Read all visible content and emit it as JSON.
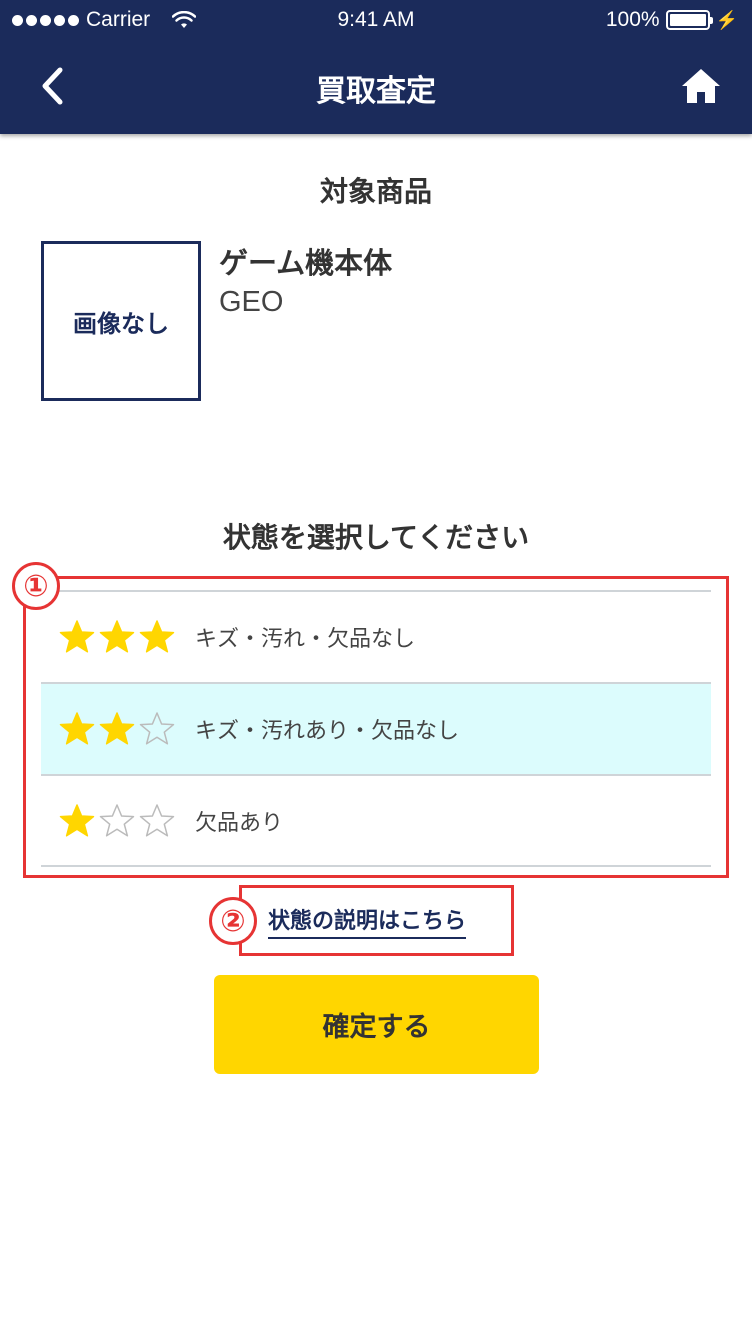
{
  "status_bar": {
    "carrier": "Carrier",
    "time": "9:41 AM",
    "battery": "100%"
  },
  "nav": {
    "title": "買取査定",
    "back_icon": "chevron-left-icon",
    "home_icon": "home-icon"
  },
  "product": {
    "section_title": "対象商品",
    "image_placeholder": "画像なし",
    "name": "ゲーム機本体",
    "brand": "GEO"
  },
  "condition": {
    "section_title": "状態を選択してください",
    "options": [
      {
        "label": "キズ・汚れ・欠品なし",
        "stars": 3,
        "selected": false
      },
      {
        "label": "キズ・汚れあり・欠品なし",
        "stars": 2,
        "selected": true
      },
      {
        "label": "欠品あり",
        "stars": 1,
        "selected": false
      }
    ],
    "explanation_link": "状態の説明はこちら"
  },
  "confirm_button": "確定する",
  "annotations": [
    "①",
    "②"
  ],
  "colors": {
    "header": "#1b2b5b",
    "accent_yellow": "#ffd600",
    "selected_row": "#dcfcfd",
    "annotation_red": "#e63434",
    "star_filled": "#ffd600",
    "star_empty_border": "#bbbbbb"
  }
}
